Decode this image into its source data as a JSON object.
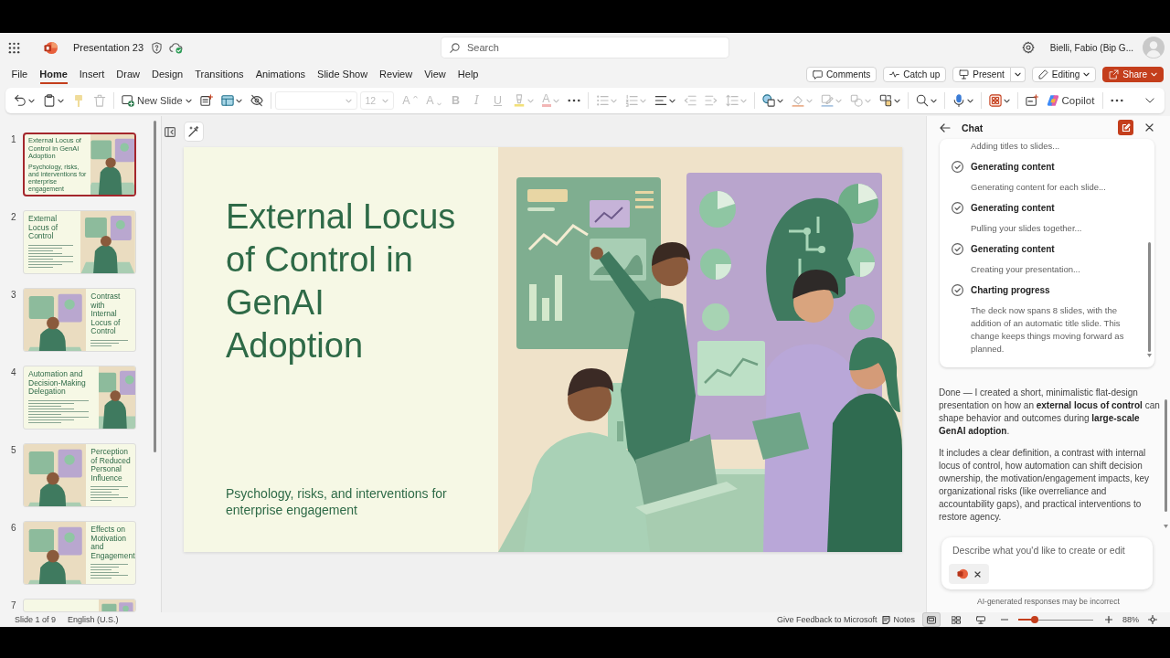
{
  "window": {
    "document_title": "Presentation 23",
    "search": {
      "placeholder": "Search"
    },
    "user_name": "Bielli, Fabio (Bip G..."
  },
  "menu_tabs": [
    {
      "label": "File",
      "selected": false
    },
    {
      "label": "Home",
      "selected": true
    },
    {
      "label": "Insert",
      "selected": false
    },
    {
      "label": "Draw",
      "selected": false
    },
    {
      "label": "Design",
      "selected": false
    },
    {
      "label": "Transitions",
      "selected": false
    },
    {
      "label": "Animations",
      "selected": false
    },
    {
      "label": "Slide Show",
      "selected": false
    },
    {
      "label": "Review",
      "selected": false
    },
    {
      "label": "View",
      "selected": false
    },
    {
      "label": "Help",
      "selected": false
    }
  ],
  "header_buttons": [
    {
      "kind": "comments",
      "label": "Comments"
    },
    {
      "kind": "catch-up",
      "label": "Catch up"
    },
    {
      "kind": "present",
      "label": "Present"
    },
    {
      "kind": "editing",
      "label": "Editing"
    },
    {
      "kind": "share",
      "label": "Share"
    }
  ],
  "toolbar": [
    {
      "items": [
        {
          "kind": "undo",
          "caret": true,
          "disabled": false
        },
        {
          "kind": "paste",
          "caret": true,
          "disabled": false
        },
        {
          "kind": "format-painter",
          "caret": false,
          "disabled": true
        },
        {
          "kind": "delete",
          "caret": false,
          "disabled": true
        }
      ]
    },
    {
      "items": [
        {
          "kind": "new-slide",
          "label": "New Slide",
          "caret": true,
          "disabled": false
        },
        {
          "kind": "designer",
          "caret": false,
          "disabled": false
        },
        {
          "kind": "layout",
          "caret": true,
          "disabled": false
        },
        {
          "kind": "hide-slide",
          "caret": false,
          "disabled": false
        }
      ]
    },
    {
      "items": [
        {
          "kind": "font-name",
          "caret": true,
          "disabled": true
        },
        {
          "kind": "font-size",
          "value": "12",
          "caret": true,
          "disabled": true
        },
        {
          "kind": "grow-font",
          "glyph": "A",
          "caret": false,
          "disabled": true
        },
        {
          "kind": "shrink-font",
          "glyph": "A",
          "caret": false,
          "disabled": true
        },
        {
          "kind": "bold",
          "glyph": "B",
          "caret": false,
          "disabled": true
        },
        {
          "kind": "italic",
          "glyph": "I",
          "caret": false,
          "disabled": true
        },
        {
          "kind": "underline",
          "glyph": "U",
          "caret": false,
          "disabled": true
        },
        {
          "kind": "highlight",
          "caret": true,
          "disabled": true
        },
        {
          "kind": "font-color",
          "glyph": "A",
          "caret": true,
          "disabled": true
        },
        {
          "kind": "more",
          "caret": false,
          "disabled": false
        }
      ]
    },
    {
      "items": [
        {
          "kind": "bullets",
          "caret": true,
          "disabled": true
        },
        {
          "kind": "numbering",
          "caret": true,
          "disabled": true
        },
        {
          "kind": "align",
          "caret": true,
          "disabled": false
        },
        {
          "kind": "outdent",
          "caret": false,
          "disabled": true
        },
        {
          "kind": "indent",
          "caret": false,
          "disabled": true
        },
        {
          "kind": "line-spacing",
          "caret": true,
          "disabled": true
        }
      ]
    },
    {
      "items": [
        {
          "kind": "shapes",
          "caret": true,
          "disabled": false
        },
        {
          "kind": "fill",
          "caret": true,
          "disabled": true
        },
        {
          "kind": "outline",
          "caret": true,
          "disabled": true
        },
        {
          "kind": "shape-arrange",
          "caret": true,
          "disabled": true
        },
        {
          "kind": "arrange",
          "caret": true,
          "disabled": false
        }
      ]
    },
    {
      "items": [
        {
          "kind": "find",
          "caret": true,
          "disabled": false
        }
      ]
    },
    {
      "items": [
        {
          "kind": "dictate",
          "caret": true,
          "disabled": false
        }
      ]
    },
    {
      "items": [
        {
          "kind": "designer-app",
          "caret": true,
          "disabled": false
        }
      ]
    },
    {
      "items": [
        {
          "kind": "add-ins",
          "caret": false,
          "disabled": false
        },
        {
          "kind": "copilot",
          "label": "Copilot",
          "caret": false,
          "disabled": false
        }
      ]
    },
    {
      "items": [
        {
          "kind": "more",
          "caret": false,
          "disabled": false
        }
      ]
    },
    {
      "items": [
        {
          "kind": "collapse",
          "caret": false,
          "disabled": false
        }
      ]
    }
  ],
  "slides": [
    {
      "number": "1",
      "kind": "title-image",
      "selected": true,
      "title": "External Locus of Control in GenAI Adoption",
      "subtitle": "Psychology, risks, and interventions for enterprise engagement"
    },
    {
      "number": "2",
      "kind": "text-image",
      "selected": false,
      "title": "External Locus of Control"
    },
    {
      "number": "3",
      "kind": "image-text",
      "selected": false,
      "title": "Contrast with Internal Locus of Control"
    },
    {
      "number": "4",
      "kind": "text-narrow-image",
      "selected": false,
      "title": "Automation and Decision-Making Delegation"
    },
    {
      "number": "5",
      "kind": "image-text",
      "selected": false,
      "title": "Perception of Reduced Personal Influence"
    },
    {
      "number": "6",
      "kind": "image-text",
      "selected": false,
      "title": "Effects on Motivation and Engagement"
    },
    {
      "number": "7",
      "kind": "text-narrow-image",
      "selected": false
    }
  ],
  "slide": {
    "title": "External Locus of Control in GenAI Adoption",
    "subtitle": "Psychology, risks, and interventions for enterprise engagement"
  },
  "chat": {
    "title": "Chat",
    "steps": [
      {
        "detail": "Adding titles to slides..."
      },
      {
        "title": "Generating content",
        "done": true,
        "detail": "Generating content for each slide..."
      },
      {
        "title": "Generating content",
        "done": true,
        "detail": "Pulling your slides together..."
      },
      {
        "title": "Generating content",
        "done": true,
        "detail": "Creating your presentation..."
      },
      {
        "title": "Charting progress",
        "done": true,
        "detail": "The deck now spans 8 slides, with the addition of an automatic title slide. This change keeps things moving forward as planned."
      }
    ],
    "messages": [
      "Done — I created a short, minimalistic flat-design presentation on how an **external locus of control** can shape behavior and outcomes during **large-scale GenAI adoption**.",
      "It includes a clear definition, a contrast with internal locus of control, how automation can shift decision ownership, the motivation/engagement impacts, key organizational risks (like overreliance and accountability gaps), and practical interventions to restore agency."
    ],
    "composer": {
      "placeholder": "Describe what you'd like to create or edit"
    },
    "disclaimer": "AI-generated responses may be incorrect"
  },
  "status_bar": {
    "slide_indicator": "Slide 1 of 9",
    "language": "English (U.S.)",
    "feedback": "Give Feedback to Microsoft",
    "notes": "Notes",
    "views": [
      {
        "kind": "normal",
        "selected": true
      },
      {
        "kind": "sorter",
        "selected": false
      },
      {
        "kind": "reading",
        "selected": false
      }
    ],
    "zoom": {
      "level": 0.22,
      "reading": "88%"
    }
  }
}
